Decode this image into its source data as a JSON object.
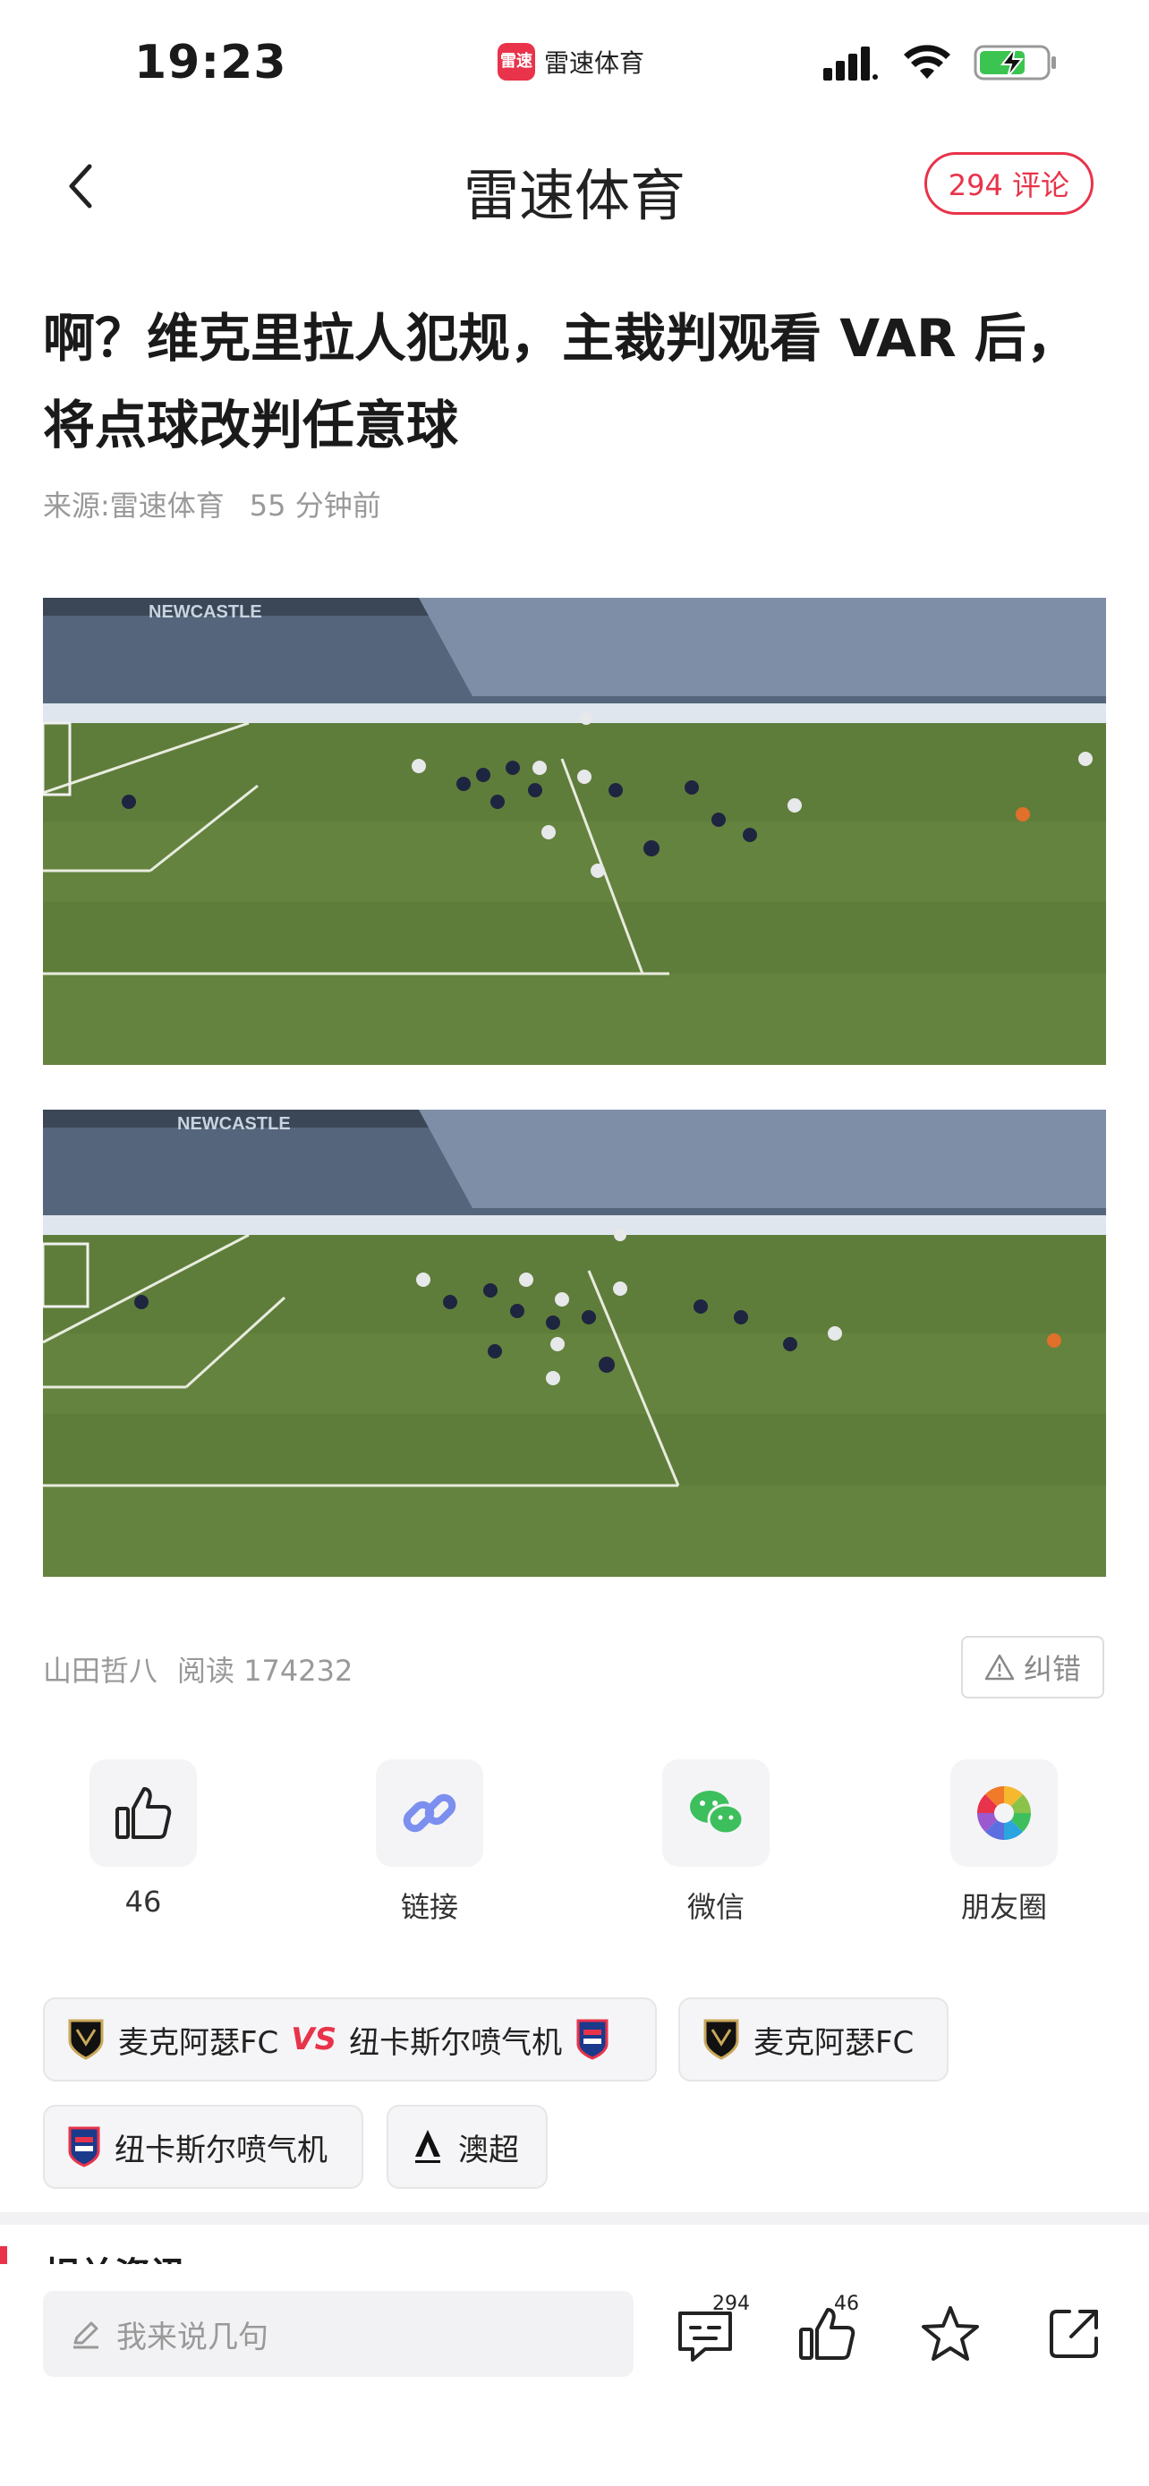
{
  "status_bar": {
    "time": "19:23",
    "app_logo_text": "雷速",
    "app_name": "雷速体育"
  },
  "nav": {
    "title": "雷速体育",
    "comment_pill": "294 评论"
  },
  "article": {
    "title": "啊？维克里拉人犯规，主裁判观看 VAR 后，将点球改判任意球",
    "source": "来源:雷速体育",
    "time_ago": "55 分钟前",
    "images": [
      {
        "stadium_text": "NEWCASTLE"
      },
      {
        "stadium_text": "NEWCASTLE"
      }
    ],
    "author": "山田哲八",
    "reads": "阅读 174232",
    "report_label": "纠错"
  },
  "share": {
    "items": [
      {
        "icon": "thumbs-up-icon",
        "label": "46"
      },
      {
        "icon": "link-icon",
        "label": "链接"
      },
      {
        "icon": "wechat-icon",
        "label": "微信"
      },
      {
        "icon": "moments-icon",
        "label": "朋友圈"
      }
    ]
  },
  "tags": {
    "match_home": "麦克阿瑟FC",
    "match_vs": "VS",
    "match_away": "纽卡斯尔喷气机",
    "team1": "麦克阿瑟FC",
    "team2": "纽卡斯尔喷气机",
    "league": "澳超"
  },
  "related": {
    "heading": "相关资讯"
  },
  "bottom_bar": {
    "input_placeholder": "我来说几句",
    "comment_count": "294",
    "like_count": "46"
  },
  "colors": {
    "accent": "#e8334a",
    "pitch": "#5d7a3a",
    "wechat_green": "#3cbf5c",
    "link_blue": "#7c8ff0"
  }
}
